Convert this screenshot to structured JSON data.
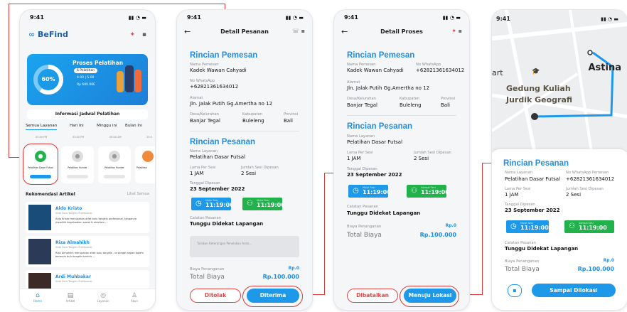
{
  "status_time": "9:41",
  "p1": {
    "app_name": "BeFind",
    "progress_title": "Proses Pelatihan",
    "progress_percent": "60%",
    "progress_value": 0.6,
    "stat_pelatihan": "6 Pelatihan",
    "stat_rating": "4.90 | 5.00",
    "stat_price": "Rp 600.00E",
    "schedule_title": "Informasi Jadwal Pelatihan",
    "tabs": [
      "Semua Layanan",
      "Hari Ini",
      "Minggu ini",
      "Bulan Ini"
    ],
    "times": [
      "04:00 PM",
      "03:00 PM",
      "08:00 AM",
      "10:0"
    ],
    "cards": [
      "Pelatihan Dasar Futsal",
      "Pelatihan Hunder",
      "Pelatihan Hunder",
      "Pelatihan"
    ],
    "reco_title": "Rekomendasi Artikel",
    "reco_all": "Lihat Semua",
    "articles": [
      {
        "name": "Aldo Kristo",
        "role": "Atlet Bulu Tangkis Profesional",
        "text": "Aldo Kristo merupakan atlet bulu tangkis profesional, tanganya memiliki kepribadian sosial & elastism ..."
      },
      {
        "name": "Riza Almahikh",
        "role": "Atlet Bulu Tangkis Profesional",
        "text": "Riza Almahikh merupakan atlet bulu tangkis , ia sangat sepak dalam bermain bulu tangkis terkhir ..."
      },
      {
        "name": "Ardi Muhbakar",
        "role": "Atlet Bulu Tangkis Profesional",
        "text": ""
      }
    ],
    "nav": [
      "Home",
      "Artikel",
      "Layanan",
      "Akun"
    ]
  },
  "p2": {
    "title": "Detail Pesanan",
    "s1": "Rincian Pemesan",
    "lbl_nama": "Nama Pemesan",
    "nama": "Kadek Wawan Cahyadi",
    "lbl_wa": "No WhatsApp",
    "wa": "+62821361634012",
    "lbl_alamat": "Alamat",
    "alamat": "Jln. Jalak Putih Gg.Amertha no 12",
    "lbl_desa": "Desa/Kelurahan",
    "desa": "Banjar Tegal",
    "lbl_kab": "Kabupaten",
    "kab": "Buleleng",
    "lbl_prov": "Provinsi",
    "prov": "Bali",
    "s2": "Rincian Pesanan",
    "lbl_layanan": "Nama Layanan",
    "layanan": "Pelatihan Dasar Futsal",
    "lbl_lama": "Lama Per Sesi",
    "lama": "1 JAM",
    "lbl_jml": "Jumlah Sesi Dipesan",
    "jml": "2 Sesi",
    "lbl_tgl": "Tanggal Dipesan",
    "tgl": "23 September 2022",
    "sess1_lbl": "Mulai Sesi",
    "sess1": "11:19:00",
    "sess2_lbl": "Mulai Sesi",
    "sess2": "11:19:00",
    "lbl_catatan": "Catatan Pesanan",
    "catatan": "Tunggu Didekat Lapangan",
    "placeholder": "Tuliskan Keterangan Penolakan Anda...",
    "lbl_biaya": "Biaya Penanganan",
    "biaya": "Rp.0",
    "total_lbl": "Total Biaya",
    "total": "Rp.100.000",
    "reject": "Ditolak",
    "accept": "Diterima"
  },
  "p3": {
    "title": "Detail Proses",
    "s1": "Rincian Pemesan",
    "lbl_nama": "Nama Pemesan",
    "nama": "Kadek Wawan Cahyadi",
    "lbl_wa": "No WhatsApp",
    "wa": "+62821361634012",
    "lbl_alamat": "Alamat",
    "alamat": "Jln. Jalak Putih Gg.Amertha no 12",
    "lbl_desa": "Desa/Kelurahan",
    "desa": "Banjar Tegal",
    "lbl_kab": "Kabupaten",
    "kab": "Buleleng",
    "lbl_prov": "Provinsi",
    "prov": "Bali",
    "s2": "Rincian Pesanan",
    "lbl_layanan": "Nama Layanan",
    "layanan": "Pelatihan Dasar Futsal",
    "lbl_lama": "Lama Per Sesi",
    "lama": "1 JAM",
    "lbl_jml": "Jumlah Sesi Dipesan",
    "jml": "2 Sesi",
    "lbl_tgl": "Tanggal Dipesan",
    "tgl": "23 September 2022",
    "sess1_lbl": "Mulai Sesi",
    "sess1": "11:19:00",
    "sess2_lbl": "Selesai Sesi",
    "sess2": "11:19:00",
    "lbl_catatan": "Catatan Pesanan",
    "catatan": "Tunggu Didekat Lapangan",
    "lbl_biaya": "Biaya Penanganan",
    "biaya": "Rp.0",
    "total_lbl": "Total Biaya",
    "total": "Rp.100.000",
    "cancel": "Dibatalkan",
    "go": "Menuju Lokasi"
  },
  "p4": {
    "map_place": "Astina",
    "map_label1": "Gedung Kuliah",
    "map_label2": "Jurdik Geografi",
    "map_art": "art",
    "s2": "Rincian Pesanan",
    "lbl_layanan": "Nama Layanan",
    "layanan": "Pelatihan Dasar Futsal",
    "lbl_wa": "No WhatsApp Pemesan",
    "wa": "+62821361634012",
    "lbl_lama": "Lama Per Sesi",
    "lama": "1 JAM",
    "lbl_jml": "Jumlah Sesi Dipesan",
    "jml": "2 Sesi",
    "lbl_tgl": "Tanggal Dipesan",
    "tgl": "23 September 2022",
    "sess1_lbl": "Mulai Sesi",
    "sess1": "11:19:00",
    "sess2_lbl": "Selesai Sesi",
    "sess2": "11:19:00",
    "lbl_catatan": "Catatan Pesanan",
    "catatan": "Tunggu Didekat Lapangan",
    "lbl_biaya": "Biaya Penanganan",
    "biaya": "Rp.0",
    "total_lbl": "Total Biaya",
    "total": "Rp.100.000",
    "arrive": "Sampai Dilokasi"
  },
  "colors": {
    "accent": "#1e98e8",
    "green": "#22b24c",
    "red": "#d93a3a"
  }
}
